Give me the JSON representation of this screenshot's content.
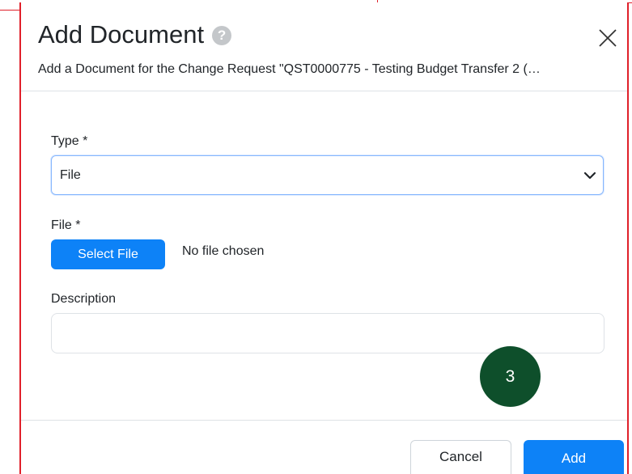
{
  "dialog": {
    "title": "Add Document",
    "help_icon_glyph": "?",
    "subtitle": "Add a Document for the Change Request \"QST0000775 - Testing Budget Transfer 2 (…",
    "close_icon": "close-icon"
  },
  "form": {
    "type_label": "Type *",
    "type_value": "File",
    "file_label": "File *",
    "select_file_label": "Select File",
    "no_file_text": "No file chosen",
    "description_label": "Description",
    "description_value": ""
  },
  "badge": {
    "step_number": "3",
    "color": "#0e4f2b"
  },
  "footer": {
    "cancel_label": "Cancel",
    "add_label": "Add"
  },
  "colors": {
    "primary": "#0d82f7",
    "annotation": "#e0202a"
  }
}
